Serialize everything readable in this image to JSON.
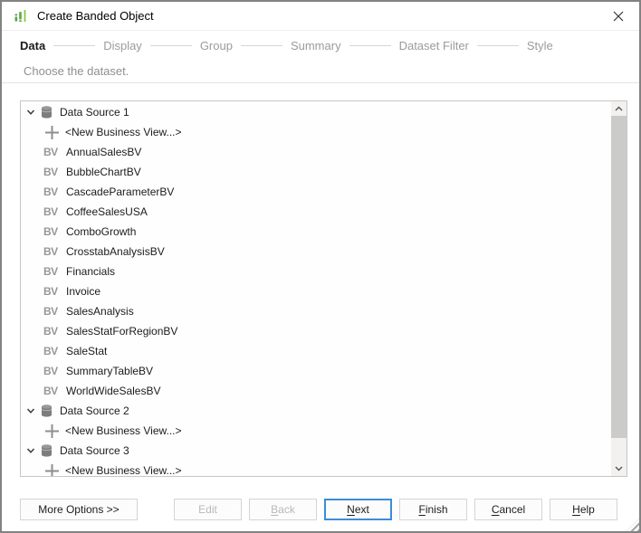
{
  "window": {
    "title": "Create Banded Object"
  },
  "icons": {
    "app": "bar-chart-icon",
    "close": "close-icon",
    "expander": "chevron-down-icon",
    "datasource": "database-icon",
    "new_view": "plus-icon",
    "business_view": "bv-badge-icon",
    "scroll_up": "chevron-up-icon",
    "scroll_down": "chevron-down-icon",
    "resize": "resize-grip-icon"
  },
  "colors": {
    "accent_green": "#5aa648",
    "accent_green_light": "#8dc63f",
    "focus_blue": "#3c8dd8",
    "step_active": "#1a1a1a",
    "step_inactive": "#9b9b9b",
    "disabled_text": "#b8b8b8"
  },
  "steps": {
    "items": [
      {
        "label": "Data",
        "active": true
      },
      {
        "label": "Display",
        "active": false
      },
      {
        "label": "Group",
        "active": false
      },
      {
        "label": "Summary",
        "active": false
      },
      {
        "label": "Dataset Filter",
        "active": false
      },
      {
        "label": "Style",
        "active": false
      }
    ]
  },
  "subtitle": "Choose the dataset.",
  "tree": {
    "bv_badge": "BV",
    "nodes": [
      {
        "type": "datasource",
        "label": "Data Source 1",
        "expanded": true,
        "children": [
          {
            "type": "new",
            "label": "<New Business View...>"
          },
          {
            "type": "bv",
            "label": "AnnualSalesBV"
          },
          {
            "type": "bv",
            "label": "BubbleChartBV"
          },
          {
            "type": "bv",
            "label": "CascadeParameterBV"
          },
          {
            "type": "bv",
            "label": "CoffeeSalesUSA"
          },
          {
            "type": "bv",
            "label": "ComboGrowth"
          },
          {
            "type": "bv",
            "label": "CrosstabAnalysisBV"
          },
          {
            "type": "bv",
            "label": "Financials"
          },
          {
            "type": "bv",
            "label": "Invoice"
          },
          {
            "type": "bv",
            "label": "SalesAnalysis"
          },
          {
            "type": "bv",
            "label": "SalesStatForRegionBV"
          },
          {
            "type": "bv",
            "label": "SaleStat"
          },
          {
            "type": "bv",
            "label": "SummaryTableBV"
          },
          {
            "type": "bv",
            "label": "WorldWideSalesBV"
          }
        ]
      },
      {
        "type": "datasource",
        "label": "Data Source 2",
        "expanded": true,
        "children": [
          {
            "type": "new",
            "label": "<New Business View...>"
          }
        ]
      },
      {
        "type": "datasource",
        "label": "Data Source 3",
        "expanded": true,
        "children": [
          {
            "type": "new",
            "label": "<New Business View...>"
          }
        ]
      }
    ]
  },
  "footer": {
    "more_options": "More Options >>",
    "buttons": [
      {
        "id": "edit",
        "label": "Edit",
        "disabled": true,
        "mnemonic": false,
        "default": false
      },
      {
        "id": "back",
        "label": "Back",
        "disabled": true,
        "mnemonic": true,
        "default": false
      },
      {
        "id": "next",
        "label": "Next",
        "disabled": false,
        "mnemonic": true,
        "default": true
      },
      {
        "id": "finish",
        "label": "Finish",
        "disabled": false,
        "mnemonic": true,
        "default": false
      },
      {
        "id": "cancel",
        "label": "Cancel",
        "disabled": false,
        "mnemonic": true,
        "default": false
      },
      {
        "id": "help",
        "label": "Help",
        "disabled": false,
        "mnemonic": true,
        "default": false
      }
    ]
  }
}
